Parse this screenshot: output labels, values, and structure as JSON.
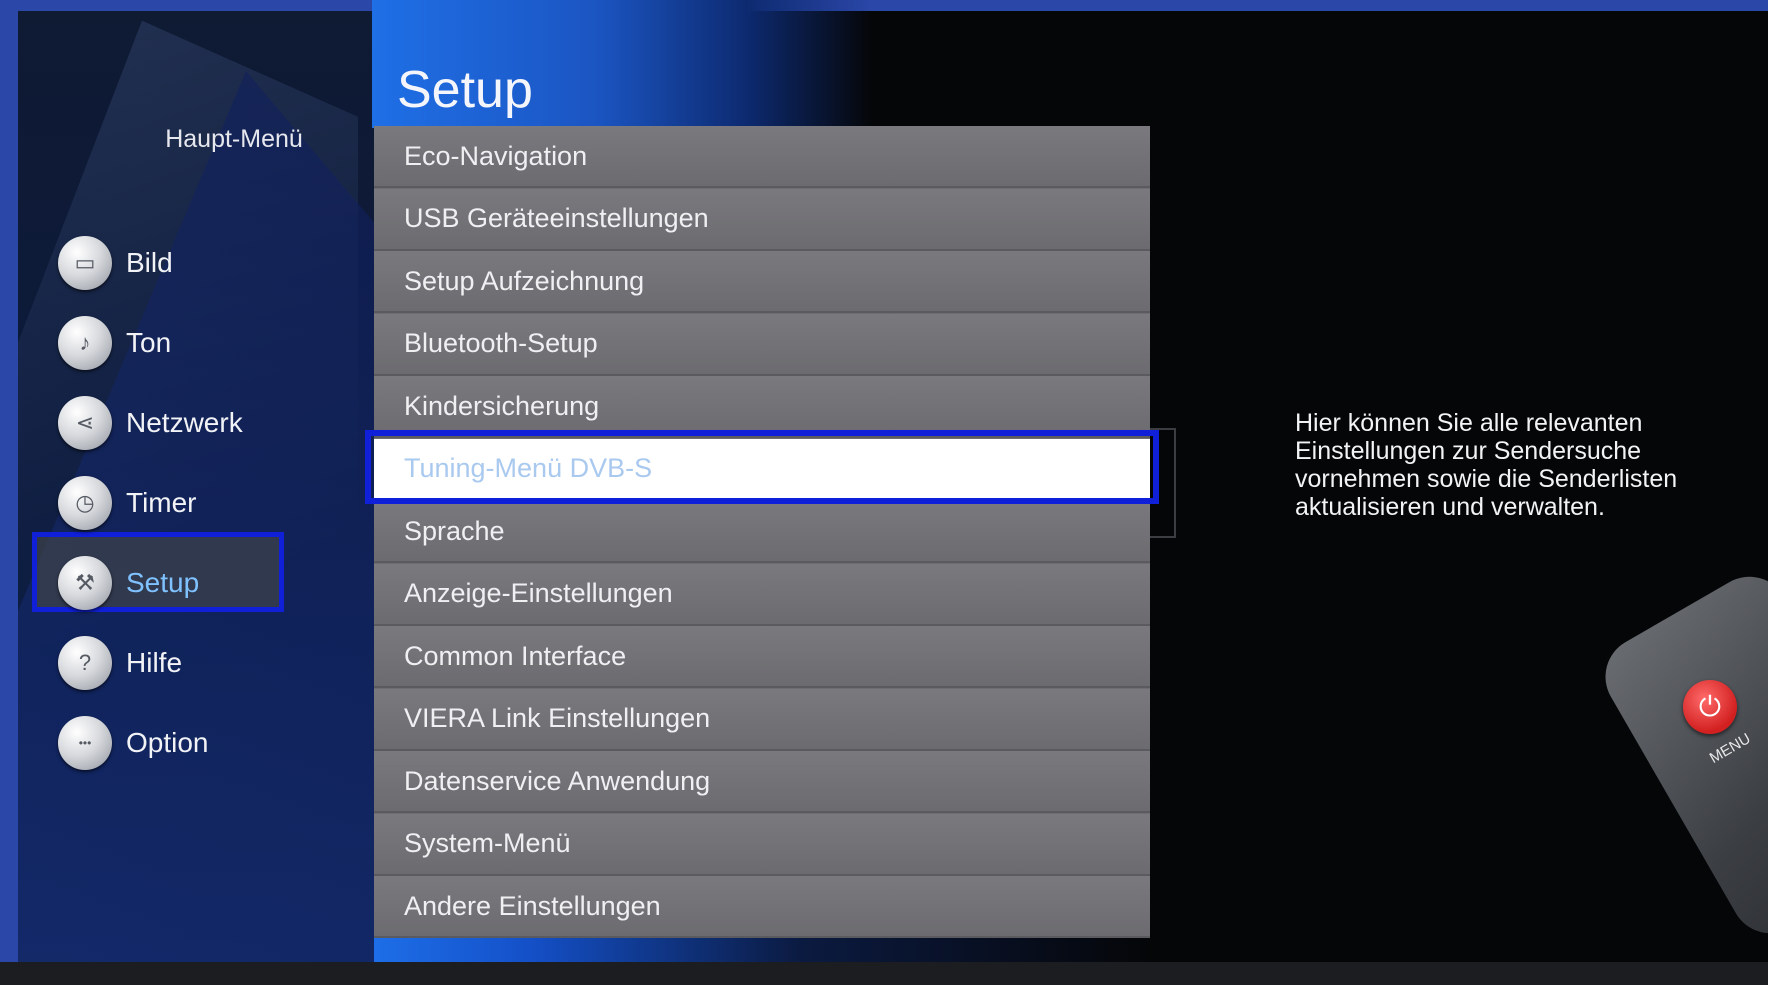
{
  "main_menu": {
    "title": "Haupt-Menü",
    "items": [
      {
        "label": "Bild",
        "icon": "tv-icon",
        "active": false
      },
      {
        "label": "Ton",
        "icon": "music-note-icon",
        "active": false
      },
      {
        "label": "Netzwerk",
        "icon": "share-network-icon",
        "active": false
      },
      {
        "label": "Timer",
        "icon": "clock-icon",
        "active": false
      },
      {
        "label": "Setup",
        "icon": "wrench-icon",
        "active": true
      },
      {
        "label": "Hilfe",
        "icon": "help-icon",
        "active": false
      },
      {
        "label": "Option",
        "icon": "option-dots-icon",
        "active": false
      }
    ]
  },
  "setup_menu": {
    "title": "Setup",
    "items": [
      {
        "label": "Eco-Navigation",
        "selected": false
      },
      {
        "label": "USB Geräteeinstellungen",
        "selected": false
      },
      {
        "label": "Setup Aufzeichnung",
        "selected": false
      },
      {
        "label": "Bluetooth-Setup",
        "selected": false
      },
      {
        "label": "Kindersicherung",
        "selected": false
      },
      {
        "label": "Tuning-Menü DVB-S",
        "selected": true
      },
      {
        "label": "Sprache",
        "selected": false
      },
      {
        "label": "Anzeige-Einstellungen",
        "selected": false
      },
      {
        "label": "Common Interface",
        "selected": false
      },
      {
        "label": "VIERA Link Einstellungen",
        "selected": false
      },
      {
        "label": "Datenservice Anwendung",
        "selected": false
      },
      {
        "label": "System-Menü",
        "selected": false
      },
      {
        "label": "Andere Einstellungen",
        "selected": false
      }
    ]
  },
  "description": "Hier können Sie alle relevanten Einstellungen zur Sendersuche vornehmen sowie die Senderlisten aktualisieren und verwalten.",
  "remote": {
    "power_symbol": "⏻",
    "menu_label": "MENU"
  },
  "colors": {
    "highlight_frame": "#1020d8",
    "accent_blue": "#1f6fe6",
    "active_label": "#7fc2ff",
    "selected_row_text": "#a9c9ef"
  }
}
